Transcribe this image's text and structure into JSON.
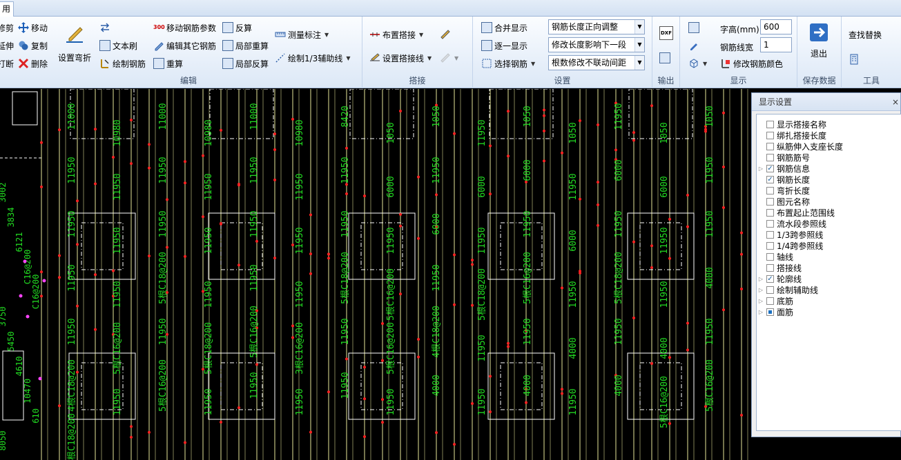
{
  "window": {
    "tab_label": "用"
  },
  "clipboard": {
    "cut": "修剪",
    "extend": "延伸",
    "break": "打断"
  },
  "edit": {
    "move": "移动",
    "copy": "复制",
    "delete": "删除",
    "set_bend": "设置弯折",
    "text_brush": "文本刷",
    "draw_rebar": "绘制钢筋",
    "move_params": "移动钢筋参数",
    "edit_other": "编辑其它钢筋",
    "recalc": "重算",
    "inverse_calc": "反算",
    "local_recalc": "局部重算",
    "local_inverse": "局部反算",
    "measure": "测量标注",
    "draw_aux": "绘制1/3辅助线",
    "label": "编辑"
  },
  "lap": {
    "place_lap": "布置搭接",
    "set_lap_line": "设置搭接线",
    "label": "搭接"
  },
  "settings": {
    "merge_display": "合并显示",
    "one_by_one": "逐一显示",
    "select_rebar": "选择钢筋",
    "combo1": "钢筋长度正向调整",
    "combo2": "修改长度影响下一段",
    "combo3": "根数修改不联动间距",
    "label": "设置"
  },
  "output": {
    "dxf": "DXF",
    "label": "输出"
  },
  "display": {
    "font_height_label": "字高(mm)",
    "font_height_value": "600",
    "line_width_label": "钢筋线宽",
    "line_width_value": "1",
    "change_color": "修改钢筋颜色",
    "label": "显示"
  },
  "save": {
    "exit": "退出",
    "label": "保存数据"
  },
  "tools": {
    "find_replace": "查找替换",
    "label": "工具"
  },
  "display_panel": {
    "title": "显示设置",
    "items": [
      {
        "label": "显示搭接名称",
        "checked": false,
        "expandable": false
      },
      {
        "label": "绑扎搭接长度",
        "checked": false,
        "expandable": false
      },
      {
        "label": "纵筋伸入支座长度",
        "checked": false,
        "expandable": false
      },
      {
        "label": "钢筋筋号",
        "checked": false,
        "expandable": false
      },
      {
        "label": "钢筋信息",
        "checked": true,
        "expandable": true
      },
      {
        "label": "钢筋长度",
        "checked": true,
        "expandable": false
      },
      {
        "label": "弯折长度",
        "checked": false,
        "expandable": false
      },
      {
        "label": "图元名称",
        "checked": false,
        "expandable": false
      },
      {
        "label": "布置起止范围线",
        "checked": false,
        "expandable": false
      },
      {
        "label": "流水段参照线",
        "checked": false,
        "expandable": false
      },
      {
        "label": "1/3跨参照线",
        "checked": false,
        "expandable": false
      },
      {
        "label": "1/4跨参照线",
        "checked": false,
        "expandable": false
      },
      {
        "label": "轴线",
        "checked": false,
        "expandable": false
      },
      {
        "label": "搭接线",
        "checked": false,
        "expandable": false
      },
      {
        "label": "轮廓线",
        "checked": true,
        "expandable": true
      },
      {
        "label": "绘制辅助线",
        "checked": false,
        "expandable": true
      },
      {
        "label": "底筋",
        "checked": false,
        "expandable": true
      },
      {
        "label": "面筋",
        "checked": "partial",
        "expandable": true
      }
    ]
  },
  "canvas": {
    "colors": {
      "background": "#000000",
      "rebar": "#e8e89a",
      "text": "#22dd22",
      "outline": "#ffffff",
      "marker": "#ff2222",
      "aux": "#ff44ff"
    },
    "column_labels": [
      [
        "11000",
        "11950",
        "11950",
        "11950",
        "11950",
        "4根C18@200",
        "5根C18@200"
      ],
      [
        "10980",
        "11950",
        "11950",
        "11950",
        "5根C16@200",
        "11950"
      ],
      [
        "11000",
        "11950",
        "11950",
        "5根C18@200",
        "11950",
        "5根C16@200"
      ],
      [
        "10980",
        "11950",
        "11950",
        "11950",
        "5根C18@200",
        "11950"
      ],
      [
        "11000",
        "11950",
        "11950",
        "11950",
        "5根C16@200",
        "11950"
      ],
      [
        "10980",
        "11950",
        "11950",
        "11950",
        "3根C16@200",
        "11950"
      ],
      [
        "8420",
        "11950",
        "11950",
        "5根C18@200",
        "11950",
        "11950"
      ],
      [
        "1050",
        "6000",
        "11950",
        "5根C16@200",
        "5根C16@200",
        "11950"
      ],
      [
        "1050",
        "11950",
        "6000",
        "11950",
        "4根C18@200",
        "4000"
      ],
      [
        "11950",
        "6000",
        "11950",
        "5根C18@200",
        "11950",
        "11950"
      ],
      [
        "1050",
        "6000",
        "11950",
        "5根C16@200",
        "11950",
        "4000"
      ],
      [
        "1050",
        "11950",
        "6000",
        "11950",
        "4000",
        "11950"
      ],
      [
        "11950",
        "6000",
        "11950",
        "5根C18@200",
        "11950",
        "4000"
      ],
      [
        "1050",
        "6000",
        "11950",
        "11950",
        "4000",
        "5根C16@200"
      ],
      [
        "1050",
        "11950",
        "11950",
        "4000",
        "11950",
        "5根C16@200"
      ]
    ],
    "left_labels": [
      "3002",
      "3834",
      "6121",
      "C16@200",
      "C16@200",
      "3750",
      "5450",
      "4610",
      "10470",
      "610",
      "8050"
    ]
  }
}
